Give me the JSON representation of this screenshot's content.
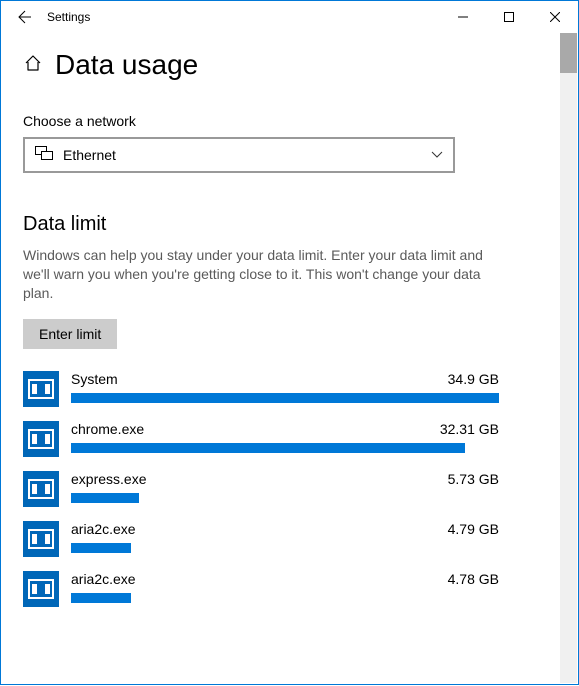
{
  "window": {
    "title": "Settings"
  },
  "header": {
    "title": "Data usage"
  },
  "network_select": {
    "label": "Choose a network",
    "value": "Ethernet"
  },
  "data_limit": {
    "heading": "Data limit",
    "description": "Windows can help you stay under your data limit. Enter your data limit and we'll warn you when you're getting close to it. This won't change your data plan.",
    "button": "Enter limit"
  },
  "apps": [
    {
      "name": "System",
      "usage": "34.9 GB",
      "pct": 100
    },
    {
      "name": "chrome.exe",
      "usage": "32.31 GB",
      "pct": 92
    },
    {
      "name": "express.exe",
      "usage": "5.73 GB",
      "pct": 16
    },
    {
      "name": "aria2c.exe",
      "usage": "4.79 GB",
      "pct": 14
    },
    {
      "name": "aria2c.exe",
      "usage": "4.78 GB",
      "pct": 14
    }
  ]
}
